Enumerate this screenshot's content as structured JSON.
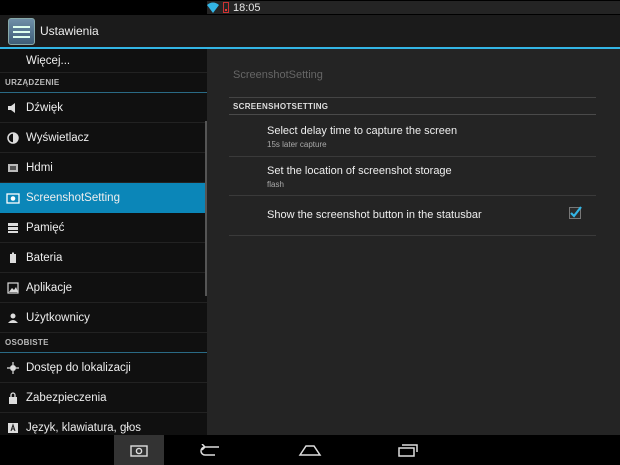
{
  "status": {
    "time": "18:05"
  },
  "action_bar": {
    "title": "Ustawienia"
  },
  "sidebar": {
    "more": "Więcej...",
    "section_device": "URZĄDZENIE",
    "device_items": [
      {
        "label": "Dźwięk",
        "icon": "speaker-icon"
      },
      {
        "label": "Wyświetlacz",
        "icon": "brightness-icon"
      },
      {
        "label": "Hdmi",
        "icon": "hdmi-icon"
      },
      {
        "label": "ScreenshotSetting",
        "icon": "camera-icon",
        "selected": true
      },
      {
        "label": "Pamięć",
        "icon": "storage-icon"
      },
      {
        "label": "Bateria",
        "icon": "battery-icon"
      },
      {
        "label": "Aplikacje",
        "icon": "apps-icon"
      },
      {
        "label": "Użytkownicy",
        "icon": "user-icon"
      }
    ],
    "section_personal": "OSOBISTE",
    "personal_items": [
      {
        "label": "Dostęp do lokalizacji",
        "icon": "location-icon"
      },
      {
        "label": "Zabezpieczenia",
        "icon": "lock-icon"
      },
      {
        "label": "Język, klawiatura, głos",
        "icon": "keyboard-icon"
      }
    ]
  },
  "detail": {
    "title": "ScreenshotSetting",
    "header": "SCREENSHOTSETTING",
    "prefs": [
      {
        "title": "Select delay time to capture the screen",
        "summary": "15s later capture"
      },
      {
        "title": "Set the location of screenshot storage",
        "summary": "flash"
      },
      {
        "title": "Show the screenshot button in the statusbar",
        "checked": true
      }
    ]
  },
  "nav": {
    "accent": "#33b5e5",
    "selected_bg": "#0b86b8"
  }
}
